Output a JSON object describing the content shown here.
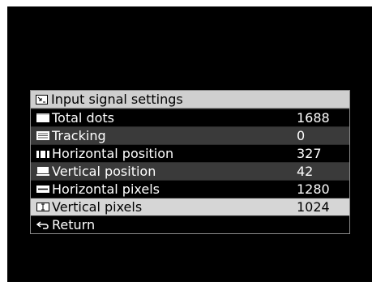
{
  "menu": {
    "title": "Input signal settings",
    "title_icon": "input-settings-icon",
    "rows": [
      {
        "label": "Total dots",
        "value": "1688",
        "icon": "total-dots-icon"
      },
      {
        "label": "Tracking",
        "value": "0",
        "icon": "tracking-icon"
      },
      {
        "label": "Horizontal position",
        "value": "327",
        "icon": "horizontal-position-icon"
      },
      {
        "label": "Vertical position",
        "value": "42",
        "icon": "vertical-position-icon"
      },
      {
        "label": "Horizontal pixels",
        "value": "1280",
        "icon": "horizontal-pixels-icon"
      },
      {
        "label": "Vertical pixels",
        "value": "1024",
        "icon": "vertical-pixels-icon"
      }
    ],
    "return_label": "Return",
    "return_icon": "return-icon",
    "selected_row": "Vertical pixels"
  },
  "colors": {
    "background": "#000000",
    "title_bar": "#cfcfcf",
    "alt_row": "#3a3a3a",
    "selected_row": "#d6d6d6",
    "border": "#8a8a8a"
  }
}
